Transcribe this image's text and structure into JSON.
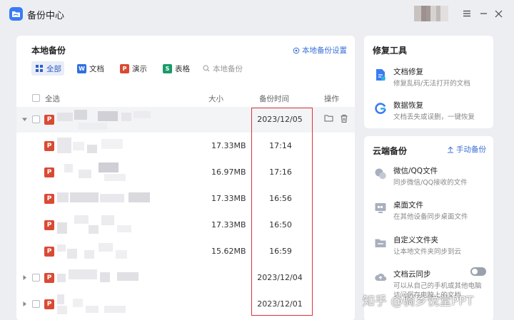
{
  "app": {
    "title": "备份中心"
  },
  "window_controls": {
    "menu": "≡",
    "minimize": "–",
    "close": "×"
  },
  "local": {
    "heading": "本地备份",
    "settings_label": "本地备份设置",
    "filters": [
      {
        "label": "全部",
        "icon": "grid-icon",
        "badge": "",
        "color": "#2f5fc4",
        "active": true
      },
      {
        "label": "文档",
        "icon": "word-icon",
        "badge": "W",
        "color": "#2f6fe0",
        "active": false
      },
      {
        "label": "演示",
        "icon": "ppt-icon",
        "badge": "P",
        "color": "#d94a34",
        "active": false
      },
      {
        "label": "表格",
        "icon": "sheet-icon",
        "badge": "S",
        "color": "#199b6a",
        "active": false
      }
    ],
    "search_placeholder": "本地备份",
    "columns": {
      "select_all": "全选",
      "size": "大小",
      "time": "备份时间",
      "action": "操作"
    },
    "groups": [
      {
        "date": "2023/12/05",
        "expanded": true,
        "files": [
          {
            "size": "17.33MB",
            "time": "17:14"
          },
          {
            "size": "16.97MB",
            "time": "17:16"
          },
          {
            "size": "17.33MB",
            "time": "16:56"
          },
          {
            "size": "17.33MB",
            "time": "16:50"
          },
          {
            "size": "15.62MB",
            "time": "16:59"
          }
        ]
      },
      {
        "date": "2023/12/04",
        "expanded": false,
        "files": []
      },
      {
        "date": "2023/12/01",
        "expanded": false,
        "files": []
      }
    ],
    "file_badge": "P"
  },
  "repair": {
    "heading": "修复工具",
    "items": [
      {
        "title": "文档修复",
        "desc": "修复乱码/无法打开的文档",
        "icon": "document-repair-icon"
      },
      {
        "title": "数据恢复",
        "desc": "文档丢失或误删，一键恢复",
        "icon": "data-recovery-icon"
      }
    ]
  },
  "cloud": {
    "heading": "云端备份",
    "manual_label": "手动备份",
    "items": [
      {
        "title": "微信/QQ文件",
        "desc": "同步微信/QQ接收的文件",
        "icon": "chat-file-icon"
      },
      {
        "title": "桌面文件",
        "desc": "在其他设备同步桌面文件",
        "icon": "desktop-icon"
      },
      {
        "title": "自定义文件夹",
        "desc": "让本地文件夹同步到云",
        "icon": "folder-icon"
      },
      {
        "title": "文档云同步",
        "desc": "可以从自己的手机或其他电脑",
        "desc2": "访问保存电脑上的文档",
        "icon": "cloud-sync-icon"
      }
    ],
    "sync_enabled": false
  },
  "watermark": "知乎 @骑乡悦堂PPT",
  "colors": {
    "accent": "#3a6fd8",
    "ppt": "#d94a34",
    "highlight": "#d9333a"
  }
}
